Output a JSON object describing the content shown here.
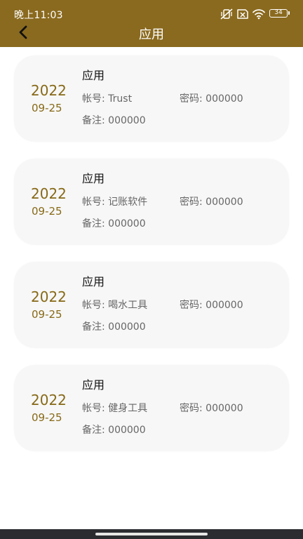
{
  "status_bar": {
    "time": "晚上11:03",
    "battery": "34",
    "icons": [
      "mute-vibrate-icon",
      "sim-missing-icon",
      "wifi-icon",
      "battery-icon"
    ]
  },
  "header": {
    "title": "应用",
    "back_icon": "chevron-left-icon",
    "background": "#8a6a1f"
  },
  "records": [
    {
      "title": "应用",
      "year": "2022",
      "month_day": "09-25",
      "account": "帐号: Trust",
      "password": "密码: 000000",
      "note": "备注: 000000"
    },
    {
      "title": "应用",
      "year": "2022",
      "month_day": "09-25",
      "account": "帐号: 记账软件",
      "password": "密码: 000000",
      "note": "备注: 000000"
    },
    {
      "title": "应用",
      "year": "2022",
      "month_day": "09-25",
      "account": "帐号: 喝水工具",
      "password": "密码: 000000",
      "note": "备注: 000000"
    },
    {
      "title": "应用",
      "year": "2022",
      "month_day": "09-25",
      "account": "帐号: 健身工具",
      "password": "密码: 000000",
      "note": "备注: 000000"
    }
  ],
  "colors": {
    "accent": "#876917",
    "card_bg": "#f7f7f7"
  }
}
